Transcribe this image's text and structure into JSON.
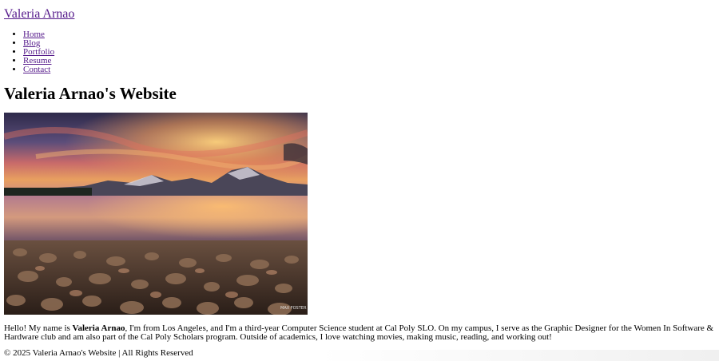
{
  "header": {
    "site_title": "Valeria Arnao"
  },
  "nav": {
    "items": [
      {
        "label": "Home"
      },
      {
        "label": "Blog"
      },
      {
        "label": "Portfolio"
      },
      {
        "label": "Resume"
      },
      {
        "label": "Contact"
      }
    ]
  },
  "main": {
    "heading": "Valeria Arnao's Website",
    "image_watermark": "MAX FOSTER",
    "intro": {
      "prefix": "Hello! My name is ",
      "name": "Valeria Arnao",
      "suffix": ", I'm from Los Angeles, and I'm a third-year Computer Science student at Cal Poly SLO. On my campus, I serve as the Graphic Designer for the Women In Software & Hardware club and am also part of the Cal Poly Scholars program. Outside of academics, I love watching movies, making music, reading, and working out!"
    }
  },
  "footer": {
    "text": "© 2025 Valeria Arnao's Website | All Rights Reserved"
  },
  "colors": {
    "link_visited": "#551a8b",
    "text": "#000000",
    "background": "#ffffff"
  }
}
